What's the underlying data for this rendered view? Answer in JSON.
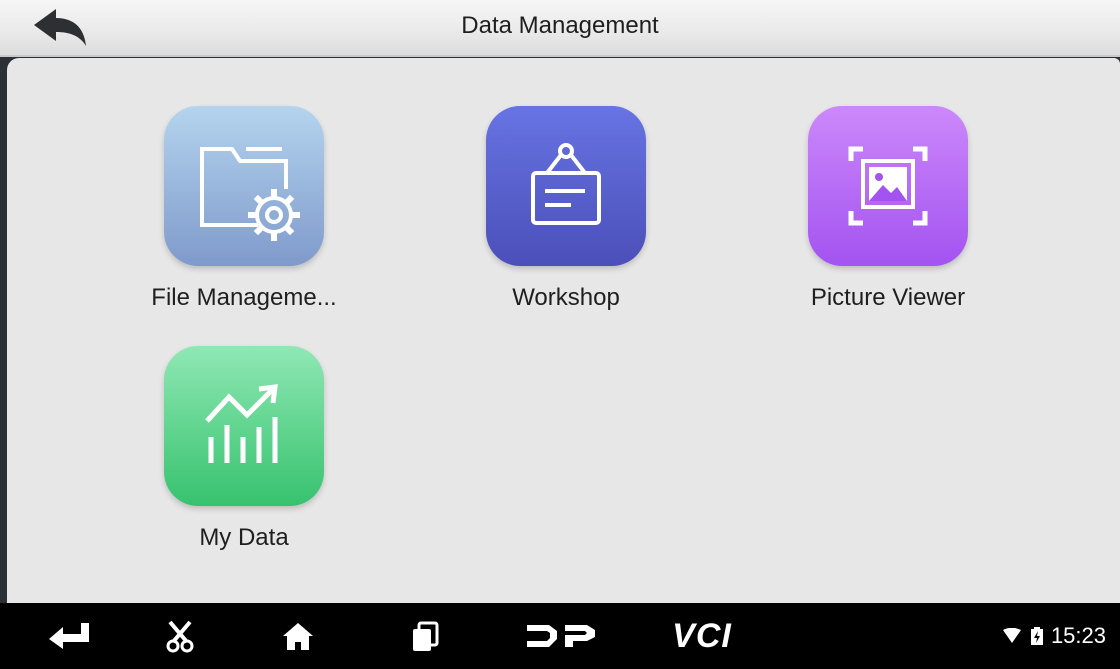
{
  "header": {
    "title": "Data Management"
  },
  "apps": [
    {
      "label": "File Manageme...",
      "icon": "folder-gear-icon",
      "color_top": "#b4d4ee",
      "color_bottom": "#7f9acb"
    },
    {
      "label": "Workshop",
      "icon": "hanging-sign-icon",
      "color_top": "#6774e3",
      "color_bottom": "#4b4fb9"
    },
    {
      "label": "Picture Viewer",
      "icon": "picture-frame-icon",
      "color_top": "#cc88fb",
      "color_bottom": "#a353f0"
    },
    {
      "label": "My Data",
      "icon": "trend-chart-icon",
      "color_top": "#8fe8b4",
      "color_bottom": "#37c26e"
    }
  ],
  "navbar": {
    "items": [
      "back-arrow-icon",
      "scissors-icon",
      "home-icon",
      "recent-apps-icon",
      "dp-logo-icon",
      "vci-icon"
    ],
    "vci_label": "VCI",
    "time": "15:23"
  }
}
